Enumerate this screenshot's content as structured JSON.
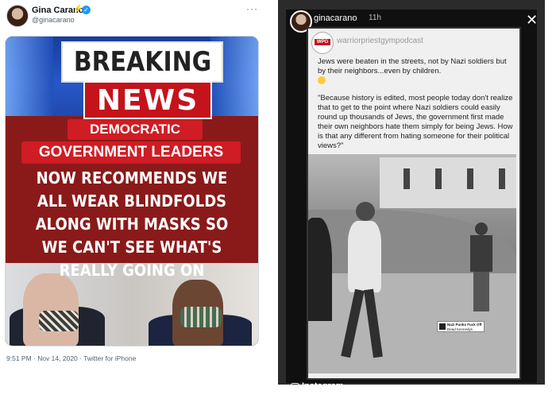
{
  "tweet": {
    "author": "Gina Carano",
    "badge_icon": "lightning-icon",
    "handle": "@ginacarano",
    "more": "···",
    "image_text": {
      "breaking": "BREAKING",
      "news": "NEWS",
      "line1": "DEMOCRATIC",
      "line2": "GOVERNMENT LEADERS",
      "headline": "NOW RECOMMENDS WE ALL WEAR BLINDFOLDS ALONG WITH MASKS SO WE CAN'T SEE WHAT'S REALLY GOING ON"
    },
    "meta": "9:51 PM · Nov 14, 2020 · Twitter for iPhone"
  },
  "story": {
    "username": "ginacarano",
    "time": "11h",
    "close": "✕",
    "embed_handle": "warriorpriestgympodcast",
    "badge": "WPG",
    "paragraph1": "Jews were beaten in the streets, not by Nazi soldiers but by their neighbors...even by children.",
    "paragraph2": "\"Because history is edited, most people today don't realize that to get to the point where Nazi soldiers could easily round up thousands of Jews, the government first made their own neighbors hate them simply for being Jews. How is that any different from hating someone for their political views?\"",
    "credit_title": "Nazi Punks Fuck Off",
    "credit_sub": "Dead Kennedys",
    "footer": "Instagram"
  }
}
